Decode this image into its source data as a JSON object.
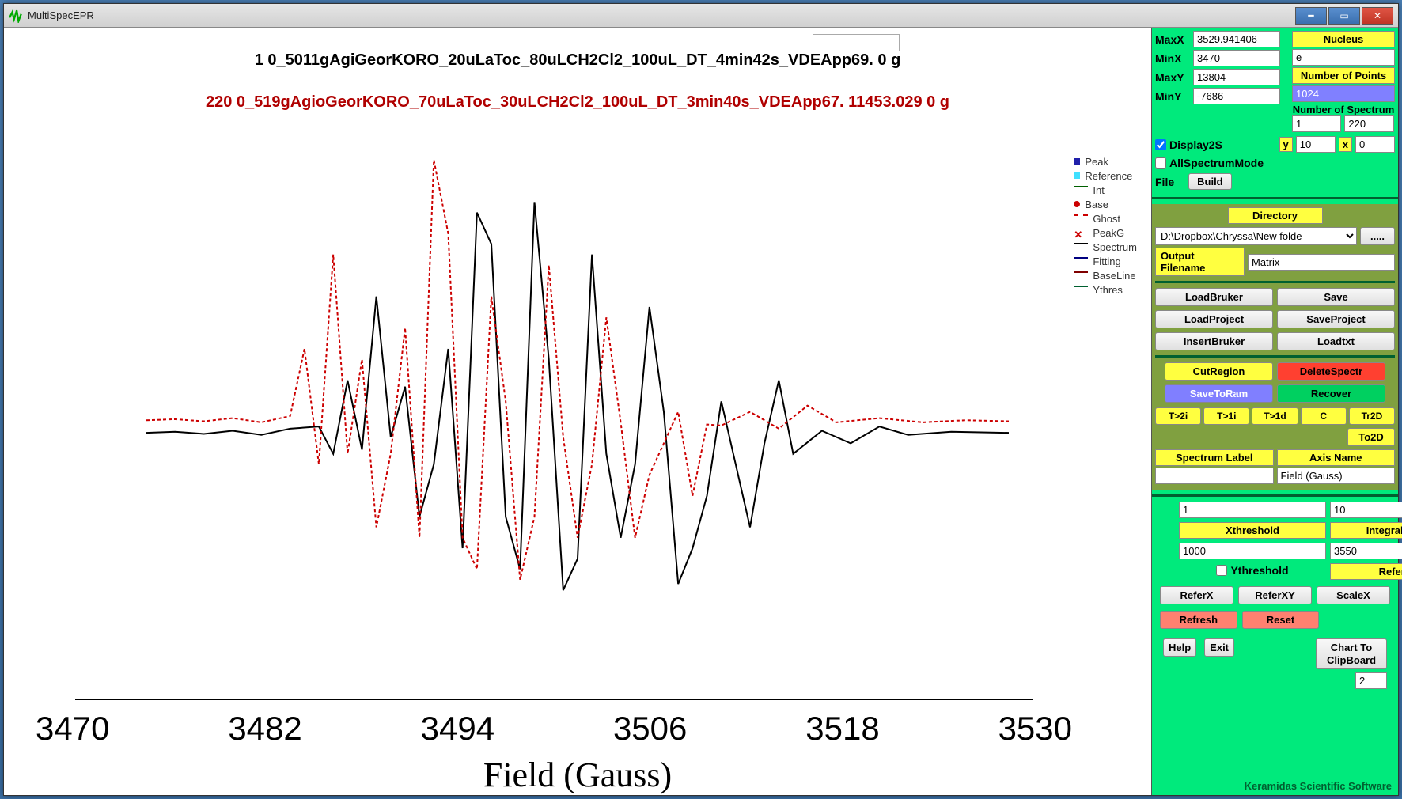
{
  "window": {
    "title": "MultiSpecEPR"
  },
  "chart": {
    "title1": "1  0_5011gAgiGeorKORO_20uLaToc_80uLCH2Cl2_100uL_DT_4min42s_VDEApp69.  0  g",
    "title2": "220  0_519gAgioGeorKORO_70uLaToc_30uLCH2Cl2_100uL_DT_3min40s_VDEApp67.  11453.029  0  g",
    "xlabel": "Field (Gauss)",
    "xticks": [
      "3470",
      "3482",
      "3494",
      "3506",
      "3518",
      "3530"
    ]
  },
  "legend": {
    "peak": "Peak",
    "reference": "Reference",
    "int": "Int",
    "base": "Base",
    "ghost": "Ghost",
    "peakg": "PeakG",
    "spectrum": "Spectrum",
    "fitting": "Fitting",
    "baseline": "BaseLine",
    "ythres": "Ythres"
  },
  "axis": {
    "maxx_label": "MaxX",
    "maxx": "3529.941406",
    "minx_label": "MinX",
    "minx": "3470",
    "maxy_label": "MaxY",
    "maxy": "13804",
    "miny_label": "MinY",
    "miny": "-7686"
  },
  "nucleus": {
    "label": "Nucleus",
    "value": "e"
  },
  "npoints": {
    "label": "Number of Points",
    "value": "1024"
  },
  "nspectrum": {
    "label": "Number of Spectrum",
    "a": "1",
    "b": "220"
  },
  "display": {
    "d2s_label": "Display2S",
    "d2s_checked": true,
    "y_label": "y",
    "y": "10",
    "x_label": "x",
    "x": "0",
    "allspec_label": "AllSpectrumMode"
  },
  "filebuild": {
    "file": "File",
    "build": "Build"
  },
  "directory": {
    "label": "Directory",
    "value": "D:\\Dropbox\\Chryssa\\New folde",
    "browse": "....."
  },
  "output": {
    "label": "Output Filename",
    "value": "Matrix"
  },
  "buttons": {
    "loadbruker": "LoadBruker",
    "save": "Save",
    "loadproject": "LoadProject",
    "saveproject": "SaveProject",
    "insertbruker": "InsertBruker",
    "loadtxt": "Loadtxt",
    "cutregion": "CutRegion",
    "deletespectr": "DeleteSpectr",
    "savetoram": "SaveToRam",
    "recover": "Recover",
    "t2i": "T>2i",
    "t1i": "T>1i",
    "t1d": "T>1d",
    "c": "C",
    "tr2d": "Tr2D",
    "to2d": "To2D"
  },
  "speclabel": {
    "label": "Spectrum Label",
    "value": ""
  },
  "axisname": {
    "label": "Axis Name",
    "value": "Field (Gauss)"
  },
  "thresh": {
    "a": "1",
    "b": "10",
    "xthresh_label": "Xthreshold",
    "integral_label": "Integral Region",
    "xthresh": "1000",
    "integral": "3550",
    "ythresh_label": "Ythreshold",
    "ref_label": "Reference"
  },
  "refbuttons": {
    "referx": "ReferX",
    "referxy": "ReferXY",
    "scalex": "ScaleX",
    "refresh": "Refresh",
    "reset": "Reset"
  },
  "bottom": {
    "help": "Help",
    "exit": "Exit",
    "chartclip": "Chart To ClipBoard",
    "chartclip_n": "2"
  },
  "footer": "Keramidas Scientific Software",
  "chart_data": {
    "type": "line",
    "xlabel": "Field (Gauss)",
    "xlim": [
      3470,
      3530
    ],
    "ylim": [
      -7686,
      13804
    ],
    "series": [
      {
        "name": "Spectrum",
        "color": "#000000",
        "x": [
          3470,
          3472,
          3474,
          3476,
          3478,
          3480,
          3482,
          3483,
          3484,
          3485,
          3486,
          3487,
          3488,
          3489,
          3490,
          3491,
          3492,
          3493,
          3494,
          3495,
          3496,
          3497,
          3498,
          3499,
          3500,
          3501,
          3502,
          3503,
          3504,
          3505,
          3506,
          3507,
          3508,
          3509,
          3510,
          3511,
          3512,
          3513,
          3514,
          3515,
          3517,
          3519,
          3521,
          3523,
          3526,
          3530
        ],
        "y": [
          0,
          50,
          -50,
          100,
          -100,
          200,
          300,
          -1000,
          2500,
          -800,
          6500,
          -200,
          2200,
          -4000,
          -1500,
          4000,
          -5500,
          10500,
          9000,
          -4000,
          -6500,
          11000,
          3500,
          -7500,
          -6000,
          8500,
          -1000,
          -5000,
          -1500,
          6000,
          1000,
          -7200,
          -5500,
          -3000,
          1500,
          -1500,
          -4500,
          -500,
          2500,
          -1000,
          100,
          -500,
          300,
          -100,
          50,
          0
        ]
      },
      {
        "name": "Ghost",
        "color": "#cc0000",
        "dashed": true,
        "x": [
          3470,
          3472,
          3474,
          3476,
          3478,
          3480,
          3481,
          3482,
          3483,
          3484,
          3485,
          3486,
          3487,
          3488,
          3489,
          3490,
          3491,
          3492,
          3493,
          3494,
          3495,
          3496,
          3497,
          3498,
          3499,
          3500,
          3501,
          3502,
          3503,
          3504,
          3505,
          3506,
          3507,
          3508,
          3509,
          3510,
          3512,
          3514,
          3516,
          3518,
          3521,
          3524,
          3527,
          3530
        ],
        "y": [
          600,
          650,
          550,
          700,
          500,
          800,
          4000,
          -1500,
          8500,
          -1000,
          3500,
          -4500,
          -1000,
          5000,
          -5000,
          13000,
          9500,
          -5000,
          -6500,
          6500,
          1500,
          -7000,
          -4000,
          8000,
          -200,
          -5000,
          -1500,
          5500,
          500,
          -5000,
          -2000,
          -500,
          1000,
          -3000,
          400,
          350,
          1000,
          200,
          1300,
          500,
          700,
          500,
          600,
          550
        ]
      }
    ]
  }
}
